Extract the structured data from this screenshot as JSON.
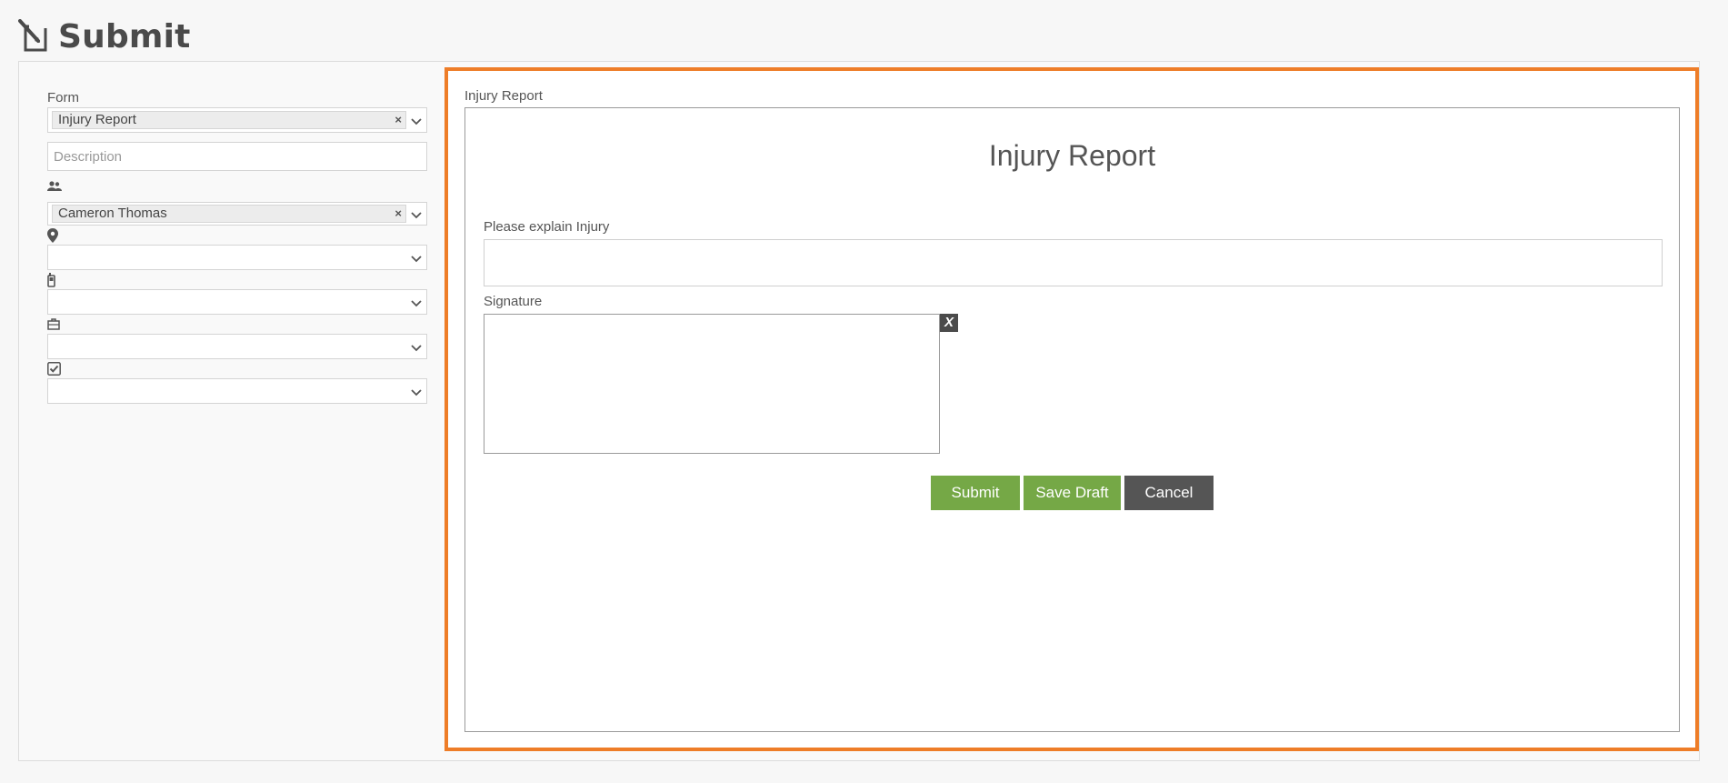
{
  "header": {
    "title": "Submit",
    "icon": "edit-form-icon"
  },
  "left_panel": {
    "form_label": "Form",
    "form_select": {
      "value": "Injury Report",
      "clear": "×"
    },
    "description": {
      "placeholder": "Description",
      "value": ""
    },
    "assignee": {
      "icon": "people-icon",
      "value": "Cameron Thomas",
      "clear": "×"
    },
    "location": {
      "icon": "map-pin-icon",
      "value": ""
    },
    "device": {
      "icon": "mobile-device-icon",
      "value": ""
    },
    "job": {
      "icon": "briefcase-icon",
      "value": ""
    },
    "task": {
      "icon": "checkbox-icon",
      "value": ""
    }
  },
  "form_panel": {
    "label": "Injury Report",
    "heading": "Injury Report",
    "questions": {
      "explain_label": "Please explain Injury",
      "signature_label": "Signature",
      "signature_clear": "X"
    },
    "buttons": {
      "submit": "Submit",
      "save_draft": "Save Draft",
      "cancel": "Cancel"
    }
  },
  "colors": {
    "accent_border": "#ee7d28",
    "primary_button": "#75a846",
    "cancel_button": "#555555"
  }
}
